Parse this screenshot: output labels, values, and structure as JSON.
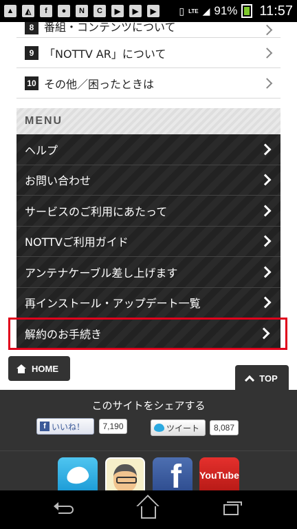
{
  "status_bar": {
    "notification_icons": [
      "image-icon",
      "image-icon",
      "facebook-icon",
      "avatar-icon",
      "nottv-icon",
      "clip-icon",
      "play-icon",
      "play-icon",
      "play-icon"
    ],
    "network": "LTE",
    "battery": "91%",
    "time": "11:57"
  },
  "faq": {
    "items": [
      {
        "num": "8",
        "label": "番組・コンテンツについて"
      },
      {
        "num": "9",
        "label": "「NOTTV AR」について"
      },
      {
        "num": "10",
        "label": "その他／困ったときは"
      }
    ]
  },
  "menu": {
    "header": "MENU",
    "items": [
      {
        "label": "ヘルプ"
      },
      {
        "label": "お問い合わせ"
      },
      {
        "label": "サービスのご利用にあたって"
      },
      {
        "label": "NOTTVご利用ガイド"
      },
      {
        "label": "アンテナケーブル差し上げます"
      },
      {
        "label": "再インストール・アップデート一覧"
      },
      {
        "label": "解約のお手続き"
      }
    ]
  },
  "home_button": "HOME",
  "top_button": "TOP",
  "share": {
    "title": "このサイトをシェアする",
    "like_label": "いいね！",
    "like_count": "7,190",
    "tweet_label": "ツイート",
    "tweet_count": "8,087",
    "youtube_label": "YouTube"
  },
  "colors": {
    "highlight": "#e0001b",
    "menu_bg": "#222222",
    "footer_bg": "#333333"
  }
}
